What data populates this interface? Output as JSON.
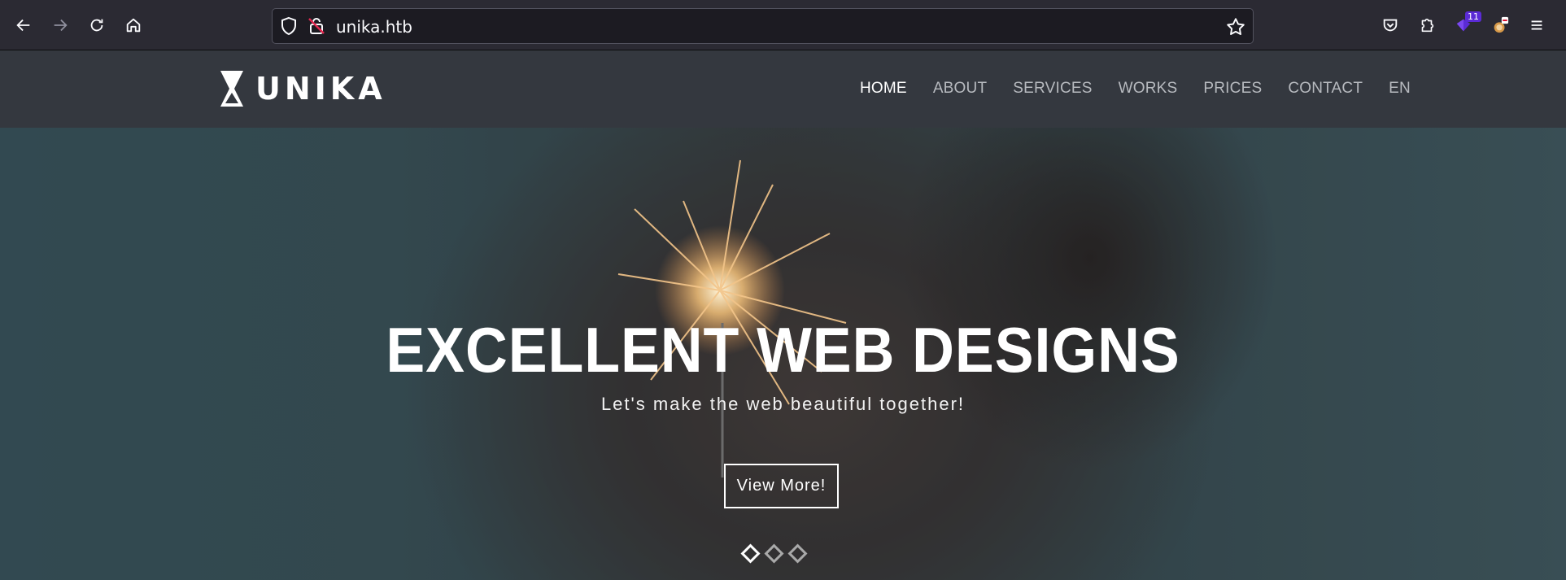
{
  "browser": {
    "url": "unika.htb",
    "extension_badge": "11",
    "icons": [
      "back-arrow-icon",
      "forward-arrow-icon",
      "reload-icon",
      "home-icon",
      "shield-icon",
      "insecure-lock-icon",
      "bookmark-star-icon",
      "pocket-icon",
      "extensions-icon",
      "extension-purple-icon",
      "extension-fox-icon",
      "hamburger-menu-icon"
    ]
  },
  "site": {
    "logo_text": "UNIKA",
    "nav": [
      "HOME",
      "ABOUT",
      "SERVICES",
      "WORKS",
      "PRICES",
      "CONTACT",
      "EN"
    ],
    "active_nav": "HOME"
  },
  "hero": {
    "title": "EXCELLENT WEB DESIGNS",
    "subtitle": "Let's make the web beautiful together!",
    "button_label": "View More!",
    "slide_count": 3,
    "active_slide": 1
  },
  "colors": {
    "toolbar_bg": "#2b2a33",
    "header_bg": "#34383f",
    "nav_inactive": "#b7babf",
    "nav_active": "#ffffff"
  }
}
